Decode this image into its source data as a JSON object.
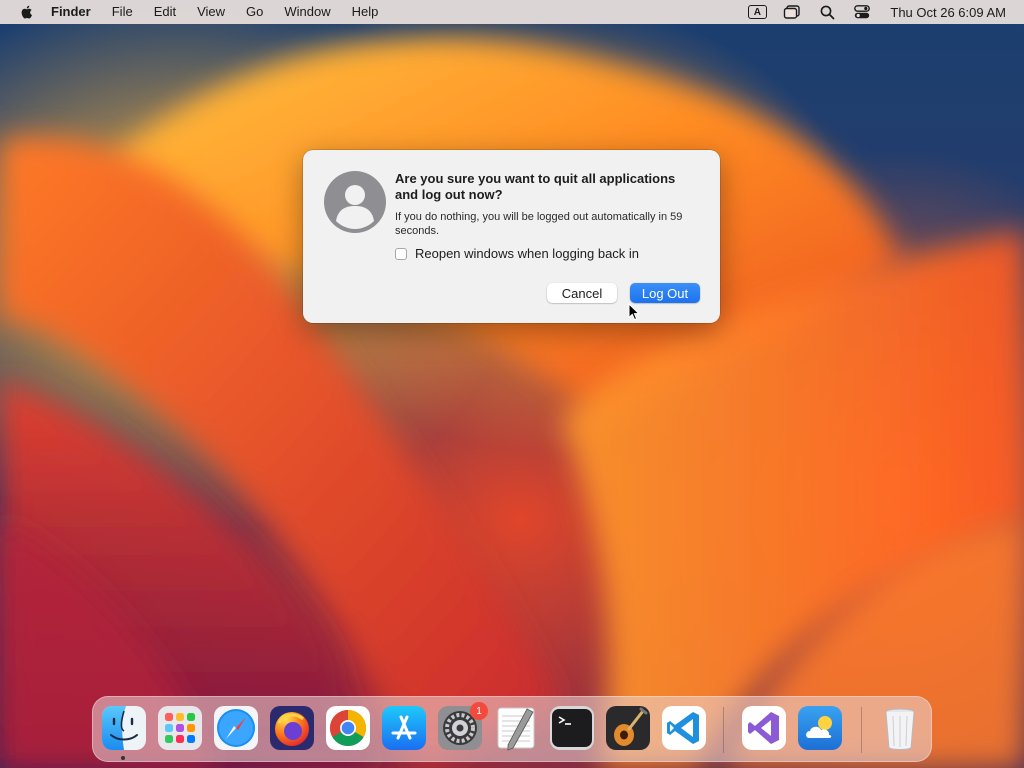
{
  "menubar": {
    "app_name": "Finder",
    "items": [
      "File",
      "Edit",
      "View",
      "Go",
      "Window",
      "Help"
    ],
    "input_source": "A",
    "clock": "Thu Oct 26  6:09 AM"
  },
  "dialog": {
    "title": "Are you sure you want to quit all applications and log out now?",
    "message": "If you do nothing, you will be logged out automatically in 59 seconds.",
    "checkbox_label": "Reopen windows when logging back in",
    "checkbox_checked": false,
    "cancel_label": "Cancel",
    "primary_label": "Log Out",
    "accent_color": "#1d72ee"
  },
  "dock": {
    "items": [
      {
        "name": "finder-icon",
        "running": true
      },
      {
        "name": "launchpad-icon"
      },
      {
        "name": "safari-icon"
      },
      {
        "name": "firefox-icon"
      },
      {
        "name": "chrome-icon"
      },
      {
        "name": "app-store-icon"
      },
      {
        "name": "system-settings-icon",
        "badge": "1"
      },
      {
        "name": "textedit-icon"
      },
      {
        "name": "terminal-icon"
      },
      {
        "name": "garageband-icon"
      },
      {
        "name": "vscode-icon"
      },
      {
        "name": "visual-studio-icon"
      },
      {
        "name": "weather-icon"
      },
      {
        "name": "trash-icon"
      }
    ],
    "badge_color": "#f34a3d"
  }
}
